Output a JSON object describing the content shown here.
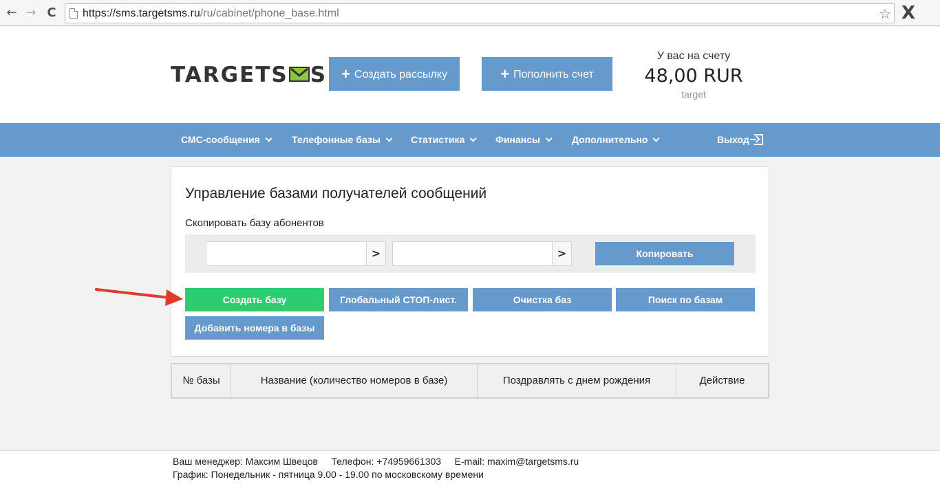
{
  "browser": {
    "url_host": "https://sms.targetsms.ru",
    "url_path": "/ru/cabinet/phone_base.html",
    "back_icon": "←",
    "forward_icon": "→",
    "reload_icon": "C",
    "star_icon": "☆",
    "close_icon": "X"
  },
  "header": {
    "logo_left": "TARGETS",
    "logo_right": "S",
    "create_mail_label": "Создать рассылку",
    "topup_label": "Пополнить счет",
    "plus_icon": "+",
    "balance_label": "У вас на счету",
    "balance_value": "48,00 RUR",
    "account_name": "target"
  },
  "nav": {
    "items": [
      {
        "label": "СМС-сообщения"
      },
      {
        "label": "Телефонные базы"
      },
      {
        "label": "Статистика"
      },
      {
        "label": "Финансы"
      },
      {
        "label": "Дополнительно"
      }
    ],
    "logout_label": "Выход"
  },
  "panel": {
    "title": "Управление базами получателей сообщений",
    "copy_label": "Скопировать базу абонентов",
    "select_from": "",
    "select_to": "",
    "select_arrow": ">",
    "copy_button": "Копировать",
    "buttons": {
      "create_base": "Создать базу",
      "global_stop": "Глобальный СТОП-лист.",
      "clear_bases": "Очистка баз",
      "search_bases": "Поиск по базам",
      "add_numbers": "Добавить номера в базы"
    }
  },
  "table": {
    "headers": [
      "№ базы",
      "Название (количество номеров в базе)",
      "Поздравлять с днем рождения",
      "Действие"
    ]
  },
  "footer": {
    "line1": "Ваш менеджер: Максим Швецов     Телефон: +74959661303     E-mail: maxim@targetsms.ru",
    "line2": "График: Понедельник - пятница 9.00 - 19.00 по московскому времени"
  },
  "colors": {
    "accent": "#6699cc",
    "create_base": "#2ecc71",
    "arrow": "#e03c2c",
    "logo_envelope": "#8cc63f"
  }
}
